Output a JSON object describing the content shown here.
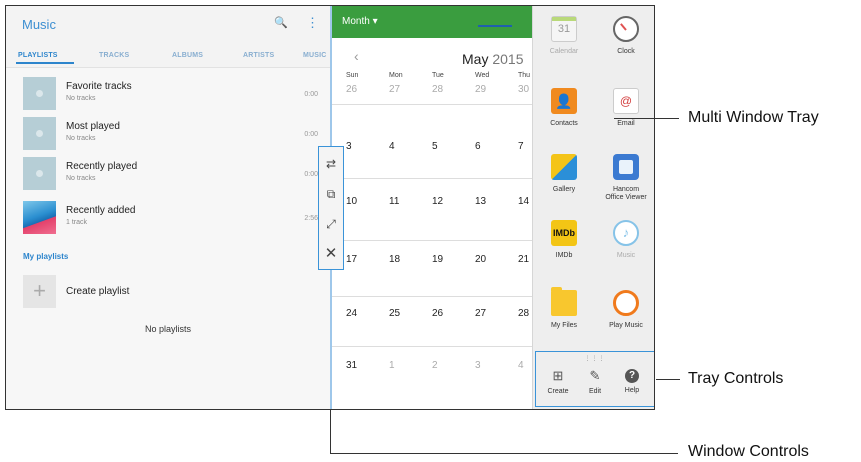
{
  "music": {
    "title": "Music",
    "tabs": [
      "PLAYLISTS",
      "TRACKS",
      "ALBUMS",
      "ARTISTS",
      "MUSIC"
    ],
    "items": [
      {
        "title": "Favorite tracks",
        "sub": "No tracks",
        "time": "0:00"
      },
      {
        "title": "Most played",
        "sub": "No tracks",
        "time": "0:00"
      },
      {
        "title": "Recently played",
        "sub": "No tracks",
        "time": "0:00"
      },
      {
        "title": "Recently added",
        "sub": "1 track",
        "time": "2:56"
      }
    ],
    "my_playlists": "My playlists",
    "create_playlist": "Create playlist",
    "no_playlists": "No playlists"
  },
  "calendar": {
    "view": "Month",
    "month": "May",
    "year": "2015",
    "days_of_week": [
      "Sun",
      "Mon",
      "Tue",
      "Wed",
      "Thu"
    ],
    "weeks": [
      [
        "26",
        "27",
        "28",
        "29",
        "30"
      ],
      [
        "3",
        "4",
        "5",
        "6",
        "7"
      ],
      [
        "10",
        "11",
        "12",
        "13",
        "14"
      ],
      [
        "17",
        "18",
        "19",
        "20",
        "21"
      ],
      [
        "24",
        "25",
        "26",
        "27",
        "28"
      ],
      [
        "31",
        "1",
        "2",
        "3",
        "4"
      ]
    ]
  },
  "tray": {
    "apps": [
      {
        "label": "Calendar",
        "icon": "calendar-icon",
        "glyph": "31"
      },
      {
        "label": "Clock",
        "icon": "clock-icon",
        "glyph": ""
      },
      {
        "label": "Contacts",
        "icon": "contacts-icon",
        "glyph": "👤"
      },
      {
        "label": "Email",
        "icon": "email-icon",
        "glyph": "@"
      },
      {
        "label": "Gallery",
        "icon": "gallery-icon",
        "glyph": ""
      },
      {
        "label": "Hancom\nOffice Viewer",
        "icon": "hancom-icon",
        "glyph": ""
      },
      {
        "label": "IMDb",
        "icon": "imdb-icon",
        "glyph": "IMDb"
      },
      {
        "label": "Music",
        "icon": "music-icon",
        "glyph": "♪"
      },
      {
        "label": "My Files",
        "icon": "folder-icon",
        "glyph": ""
      },
      {
        "label": "Play Music",
        "icon": "play-music-icon",
        "glyph": ""
      }
    ],
    "controls": [
      {
        "label": "Create",
        "icon": "create-icon",
        "glyph": "⊞"
      },
      {
        "label": "Edit",
        "icon": "edit-icon",
        "glyph": "✎"
      },
      {
        "label": "Help",
        "icon": "help-icon",
        "glyph": "?"
      }
    ]
  },
  "callouts": {
    "tray": "Multi Window Tray",
    "tray_controls": "Tray Controls",
    "window_controls": "Window Controls"
  }
}
